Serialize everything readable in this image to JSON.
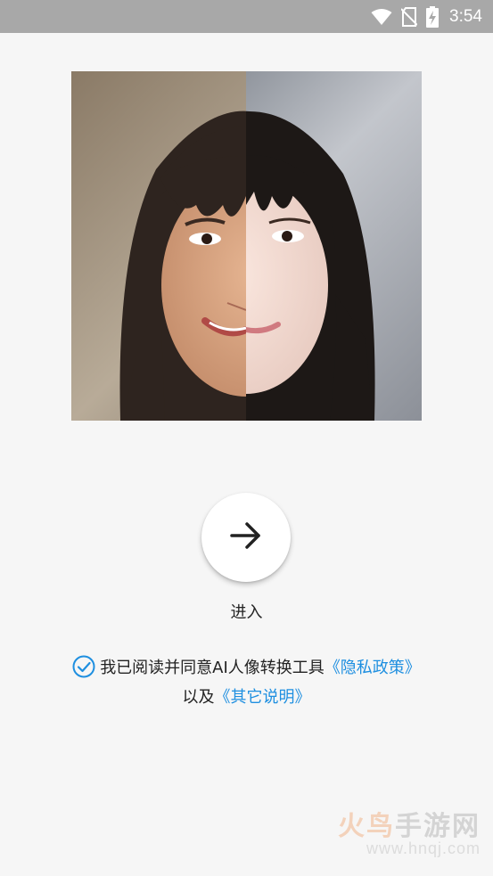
{
  "status_bar": {
    "time": "3:54",
    "icons": [
      "wifi-icon",
      "no-sim-icon",
      "battery-charging-icon"
    ]
  },
  "hero_image": {
    "description_icon": "face-comparison-image"
  },
  "enter": {
    "icon": "arrow-right-icon",
    "label": "进入"
  },
  "agreement": {
    "checked": true,
    "text": "我已阅读并同意AI人像转换工具",
    "privacy_link": "《隐私政策》",
    "connector": "以及",
    "other_link": "《其它说明》"
  },
  "watermark": {
    "title_part1": "火鸟",
    "title_part2": "手游网",
    "url": "www.hnqj.com"
  },
  "colors": {
    "status_bar": "#a8a8a8",
    "background": "#f6f6f6",
    "link": "#1e8fe0",
    "check": "#1e8fe0"
  }
}
